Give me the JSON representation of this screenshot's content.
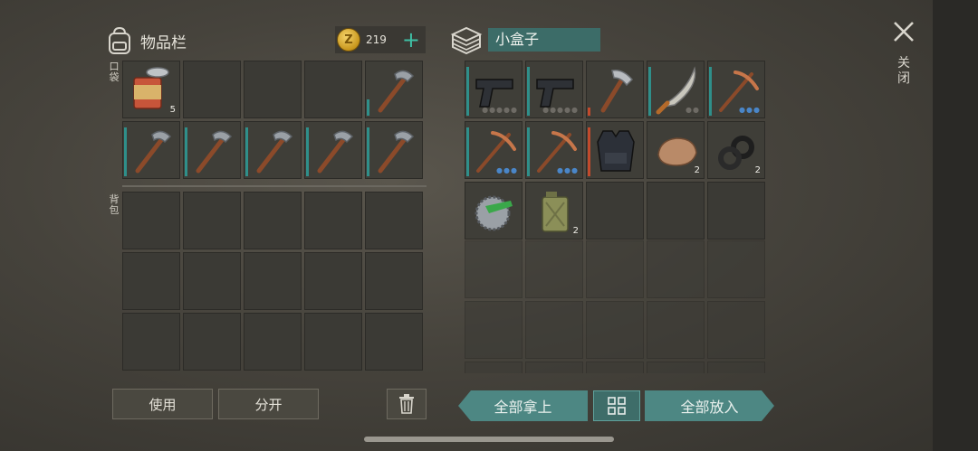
{
  "inventory": {
    "title": "物品栏",
    "coins": "219",
    "pocket_label": "口袋",
    "backpack_label": "背包",
    "pocket_slots": [
      {
        "item": "canned-food",
        "qty": "5",
        "bar": 0
      },
      {
        "item": "",
        "qty": "",
        "bar": 0
      },
      {
        "item": "",
        "qty": "",
        "bar": 0
      },
      {
        "item": "",
        "qty": "",
        "bar": 0
      },
      {
        "item": "hammer-pick",
        "qty": "",
        "bar": 0.3
      },
      {
        "item": "hammer-pick",
        "qty": "",
        "bar": 0.9
      },
      {
        "item": "hammer-pick",
        "qty": "",
        "bar": 0.9
      },
      {
        "item": "hammer-pick",
        "qty": "",
        "bar": 0.9
      },
      {
        "item": "hammer-pick",
        "qty": "",
        "bar": 0.9
      },
      {
        "item": "hammer-pick",
        "qty": "",
        "bar": 0.9
      }
    ],
    "backpack_rows": 3
  },
  "container": {
    "name": "小盒子",
    "slots": [
      {
        "item": "pistol",
        "qty": "",
        "bar": 0.9,
        "dots": "●●●●●",
        "dot_color": "#6e6b65"
      },
      {
        "item": "pistol",
        "qty": "",
        "bar": 0.9,
        "dots": "●●●●●",
        "dot_color": "#6e6b65"
      },
      {
        "item": "axe",
        "qty": "",
        "bar": 0.15,
        "bar_red": true,
        "dots": "",
        "dot_color": ""
      },
      {
        "item": "machete",
        "qty": "",
        "bar": 0.9,
        "dots": "●●",
        "dot_color": "#6e6b65"
      },
      {
        "item": "pickaxe",
        "qty": "",
        "bar": 0.9,
        "dots": "●●●",
        "dot_color": "#4a86c8"
      },
      {
        "item": "pickaxe",
        "qty": "",
        "bar": 0.9,
        "dots": "●●●",
        "dot_color": "#4a86c8"
      },
      {
        "item": "pickaxe",
        "qty": "",
        "bar": 0.9,
        "dots": "●●●",
        "dot_color": "#4a86c8"
      },
      {
        "item": "armor-vest",
        "qty": "",
        "bar": 0.9,
        "bar_red": true,
        "dots": "",
        "dot_color": ""
      },
      {
        "item": "ore",
        "qty": "2",
        "bar": 0,
        "dots": "",
        "dot_color": ""
      },
      {
        "item": "tape",
        "qty": "2",
        "bar": 0,
        "dots": "",
        "dot_color": ""
      },
      {
        "item": "saw-blade",
        "qty": "",
        "bar": 0,
        "dots": "",
        "dot_color": ""
      },
      {
        "item": "jerrycan",
        "qty": "2",
        "bar": 0,
        "dots": "",
        "dot_color": ""
      },
      {
        "item": "",
        "qty": "",
        "bar": 0
      },
      {
        "item": "",
        "qty": "",
        "bar": 0
      },
      {
        "item": "",
        "qty": "",
        "bar": 0
      }
    ],
    "locked_rows": 3
  },
  "buttons": {
    "use": "使用",
    "split": "分开",
    "take_all": "全部拿上",
    "put_all": "全部放入"
  },
  "close": {
    "label": "关闭"
  },
  "colors": {
    "accent": "#4d8783",
    "durability": "#2f8f8a",
    "coin": "#d9a52a"
  }
}
